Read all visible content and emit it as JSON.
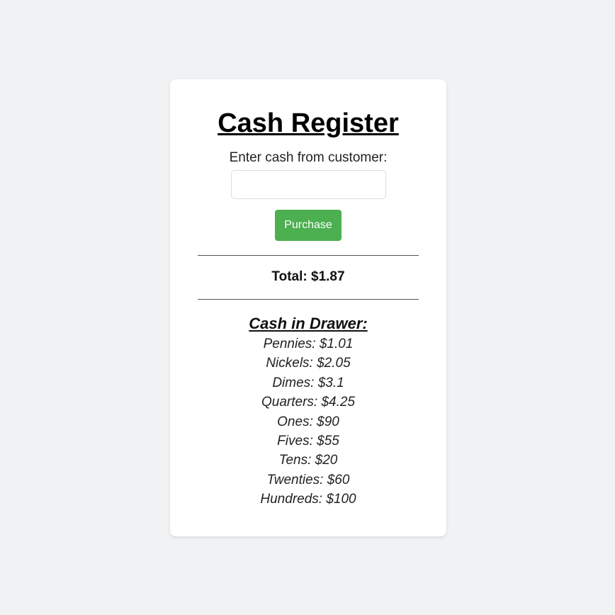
{
  "app": {
    "title": "Cash Register",
    "input_label": "Enter cash from customer:",
    "input_value": "",
    "purchase_label": "Purchase",
    "total_text": "Total: $1.87",
    "drawer_title": "Cash in Drawer:"
  },
  "drawer": [
    "Pennies: $1.01",
    "Nickels: $2.05",
    "Dimes: $3.1",
    "Quarters: $4.25",
    "Ones: $90",
    "Fives: $55",
    "Tens: $20",
    "Twenties: $60",
    "Hundreds: $100"
  ],
  "colors": {
    "page_background": "#f1f2f4",
    "card_background": "#ffffff",
    "button_background": "#4caf50",
    "button_text": "#ffffff"
  }
}
